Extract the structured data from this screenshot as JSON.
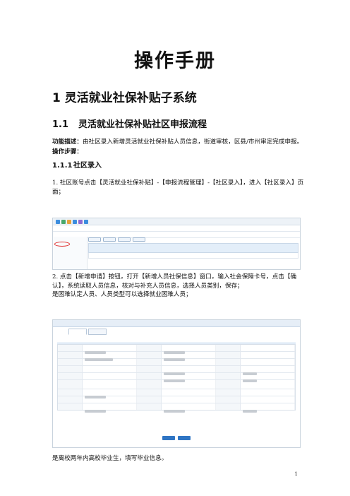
{
  "doc": {
    "title": "操作手册",
    "h1": "1  灵活就业社保补贴子系统",
    "h2_num": "1.1",
    "h2_text": "灵活就业社保补贴社区申报流程",
    "desc_label": "功能描述：",
    "desc_text": "由社区录入新增灵活就业社保补贴人员信息，街道审核，区县/市州审定完成申报。",
    "steps_label": "操作步骤：",
    "h3_num": "1.1.1",
    "h3_text": "社区录入",
    "step1": "1.   社区账号点击【灵活就业社保补贴】-【申报流程管理】-【社区录入】，进入【社区录入】页面；",
    "step2": "2.   点击【新增申请】按钮，打开【新增人员社保信息】窗口，输入社会保障卡号，点击【确认】，系统读取人员信息，核对与补充人员信息，选择人员类别，保存；",
    "step2b": "是困难认定人员、人员类型可以选择就业困难人员；",
    "after_shot": "是离校两年内高校毕业生，填写毕业信息。",
    "page_number": "1"
  }
}
